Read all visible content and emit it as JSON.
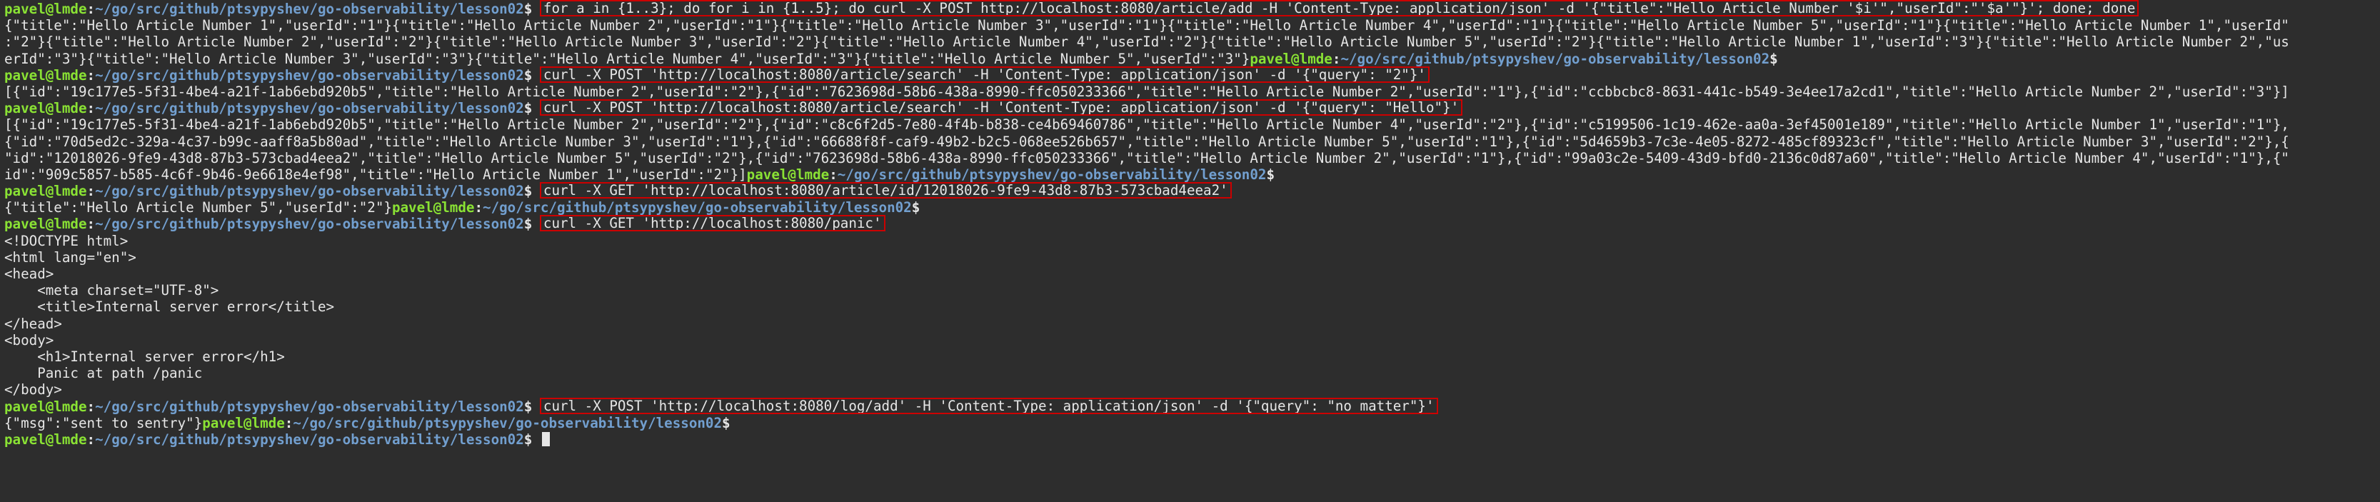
{
  "theme": {
    "background": "#2d2d2d",
    "foreground": "#e6e6e6",
    "prompt_user_color": "#8ae234",
    "prompt_path_color": "#729fcf",
    "highlight_border_color": "#cc0000"
  },
  "prompt": {
    "user_host": "pavel@lmde",
    "separator": ":",
    "path": "~/go/src/github/ptsypyshev/go-observability/lesson02",
    "symbol": "$ "
  },
  "lines": [
    {
      "type": "prompt_cmd",
      "cmd": "for a in {1..3}; do for i in {1..5}; do curl -X POST http://localhost:8080/article/add -H 'Content-Type: application/json' -d '{\"title\":\"Hello Article Number '$i'\",\"userId\":\"'$a'\"}'; done; done"
    },
    {
      "type": "output",
      "text": "{\"title\":\"Hello Article Number 1\",\"userId\":\"1\"}{\"title\":\"Hello Article Number 2\",\"userId\":\"1\"}{\"title\":\"Hello Article Number 3\",\"userId\":\"1\"}{\"title\":\"Hello Article Number 4\",\"userId\":\"1\"}{\"title\":\"Hello Article Number 5\",\"userId\":\"1\"}{\"title\":\"Hello Article Number 1\",\"userId\""
    },
    {
      "type": "output",
      "text": ":\"2\"}{\"title\":\"Hello Article Number 2\",\"userId\":\"2\"}{\"title\":\"Hello Article Number 3\",\"userId\":\"2\"}{\"title\":\"Hello Article Number 4\",\"userId\":\"2\"}{\"title\":\"Hello Article Number 5\",\"userId\":\"2\"}{\"title\":\"Hello Article Number 1\",\"userId\":\"3\"}{\"title\":\"Hello Article Number 2\",\"us"
    },
    {
      "type": "output_prompt",
      "text": "erId\":\"3\"}{\"title\":\"Hello Article Number 3\",\"userId\":\"3\"}{\"title\":\"Hello Article Number 4\",\"userId\":\"3\"}{\"title\":\"Hello Article Number 5\",\"userId\":\"3\"}"
    },
    {
      "type": "prompt_cmd",
      "cmd": "curl -X POST 'http://localhost:8080/article/search' -H 'Content-Type: application/json' -d '{\"query\": \"2\"}'"
    },
    {
      "type": "output",
      "text": "[{\"id\":\"19c177e5-5f31-4be4-a21f-1ab6ebd920b5\",\"title\":\"Hello Article Number 2\",\"userId\":\"2\"},{\"id\":\"7623698d-58b6-438a-8990-ffc050233366\",\"title\":\"Hello Article Number 2\",\"userId\":\"1\"},{\"id\":\"ccbbcbc8-8631-441c-b549-3e4ee17a2cd1\",\"title\":\"Hello Article Number 2\",\"userId\":\"3\"}]"
    },
    {
      "type": "prompt_cmd",
      "cmd": "curl -X POST 'http://localhost:8080/article/search' -H 'Content-Type: application/json' -d '{\"query\": \"Hello\"}'"
    },
    {
      "type": "output",
      "text": "[{\"id\":\"19c177e5-5f31-4be4-a21f-1ab6ebd920b5\",\"title\":\"Hello Article Number 2\",\"userId\":\"2\"},{\"id\":\"c8c6f2d5-7e80-4f4b-b838-ce4b69460786\",\"title\":\"Hello Article Number 4\",\"userId\":\"2\"},{\"id\":\"c5199506-1c19-462e-aa0a-3ef45001e189\",\"title\":\"Hello Article Number 1\",\"userId\":\"1\"},"
    },
    {
      "type": "output",
      "text": "{\"id\":\"70d5ed2c-329a-4c37-b99c-aaff8a5b80ad\",\"title\":\"Hello Article Number 3\",\"userId\":\"1\"},{\"id\":\"66688f8f-caf9-49b2-b2c5-068ee526b657\",\"title\":\"Hello Article Number 5\",\"userId\":\"1\"},{\"id\":\"5d4659b3-7c3e-4e05-8272-485cf89323cf\",\"title\":\"Hello Article Number 3\",\"userId\":\"2\"},{"
    },
    {
      "type": "output",
      "text": "\"id\":\"12018026-9fe9-43d8-87b3-573cbad4eea2\",\"title\":\"Hello Article Number 5\",\"userId\":\"2\"},{\"id\":\"7623698d-58b6-438a-8990-ffc050233366\",\"title\":\"Hello Article Number 2\",\"userId\":\"1\"},{\"id\":\"99a03c2e-5409-43d9-bfd0-2136c0d87a60\",\"title\":\"Hello Article Number 4\",\"userId\":\"1\"},{\""
    },
    {
      "type": "output_prompt",
      "text": "id\":\"909c5857-b585-4c6f-9b46-9e6618e4ef98\",\"title\":\"Hello Article Number 1\",\"userId\":\"2\"}]"
    },
    {
      "type": "prompt_cmd",
      "cmd": "curl -X GET 'http://localhost:8080/article/id/12018026-9fe9-43d8-87b3-573cbad4eea2'"
    },
    {
      "type": "output_prompt",
      "text": "{\"title\":\"Hello Article Number 5\",\"userId\":\"2\"}"
    },
    {
      "type": "prompt_cmd",
      "cmd": "curl -X GET 'http://localhost:8080/panic'"
    },
    {
      "type": "output",
      "text": "<!DOCTYPE html>"
    },
    {
      "type": "output",
      "text": "<html lang=\"en\">"
    },
    {
      "type": "output",
      "text": "<head>"
    },
    {
      "type": "output",
      "text": "    <meta charset=\"UTF-8\">"
    },
    {
      "type": "output",
      "text": "    <title>Internal server error</title>"
    },
    {
      "type": "output",
      "text": "</head>"
    },
    {
      "type": "output",
      "text": "<body>"
    },
    {
      "type": "output",
      "text": "    <h1>Internal server error</h1>"
    },
    {
      "type": "output",
      "text": "    Panic at path /panic"
    },
    {
      "type": "output",
      "text": "</body>"
    },
    {
      "type": "prompt_cmd",
      "cmd": "curl -X POST 'http://localhost:8080/log/add' -H 'Content-Type: application/json' -d '{\"query\": \"no matter\"}'"
    },
    {
      "type": "output_prompt",
      "text": "{\"msg\":\"sent to sentry\"}"
    },
    {
      "type": "prompt_cursor"
    }
  ]
}
